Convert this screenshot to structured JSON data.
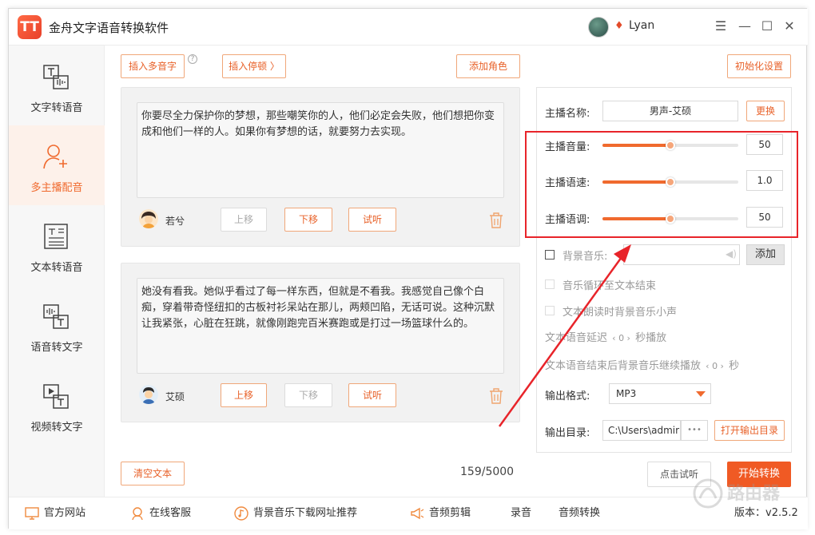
{
  "app": {
    "title": "金舟文字语音转换软件",
    "logo_char": "TT",
    "username": "Lyan",
    "vip_icon": "diamond-icon"
  },
  "window_controls": {
    "menu": "☰",
    "minimize": "—",
    "maximize": "☐",
    "close": "✕"
  },
  "sidebar": {
    "items": [
      {
        "label": "文字转语音",
        "icon": "text-to-speech-icon",
        "active": false
      },
      {
        "label": "多主播配音",
        "icon": "add-user-icon",
        "active": true
      },
      {
        "label": "文本转语音",
        "icon": "document-icon",
        "active": false
      },
      {
        "label": "语音转文字",
        "icon": "speech-to-text-icon",
        "active": false
      },
      {
        "label": "视频转文字",
        "icon": "video-to-text-icon",
        "active": false
      }
    ]
  },
  "toolbar": {
    "insert_polyphone": "插入多音字",
    "help": "?",
    "insert_pause": "插入停顿 〉",
    "add_role": "添加角色",
    "init_settings": "初始化设置"
  },
  "cards": [
    {
      "text": "你要尽全力保护你的梦想，那些嘲笑你的人，他们必定会失败，他们想把你变成和他们一样的人。如果你有梦想的话，就要努力去实现。",
      "speaker": "若兮",
      "move_up": "上移",
      "move_down": "下移",
      "listen": "试听"
    },
    {
      "text": "她没有看我。她似乎看过了每一样东西，但就是不看我。我感觉自己像个白痴，穿着带奇怪纽扣的古板衬衫呆站在那儿，两颊凹陷，无话可说。这种沉默让我紧张，心脏在狂跳，就像刚跑完百米赛跑或是打过一场篮球什么的。",
      "speaker": "艾硕",
      "move_up": "上移",
      "move_down": "下移",
      "listen": "试听"
    }
  ],
  "clear_text": "清空文本",
  "char_count": "159/5000",
  "settings": {
    "anchor_label": "主播名称:",
    "anchor_value": "男声-艾硕",
    "change": "更换",
    "volume_label": "主播音量:",
    "volume_value": "50",
    "volume_level": 0.5,
    "speed_label": "主播语速:",
    "speed_value": "1.0",
    "speed_level": 0.5,
    "pitch_label": "主播语调:",
    "pitch_value": "50",
    "pitch_level": 0.5,
    "bgm_label": "背景音乐:",
    "bgm_add": "添加",
    "loop_label": "音乐循环至文本结束",
    "duck_label": "文本朗读时背景音乐小声",
    "delay_label": "文本语音延迟",
    "delay_value": "0",
    "delay_unit": "秒播放",
    "continue_label": "文本语音结束后背景音乐继续播放",
    "continue_value": "0",
    "continue_unit": "秒",
    "format_label": "输出格式:",
    "format_value": "MP3",
    "dir_label": "输出目录:",
    "dir_value": "C:\\Users\\admir",
    "dir_more": "•••",
    "open_dir": "打开输出目录"
  },
  "actions": {
    "preview": "点击试听",
    "start": "开始转换"
  },
  "bottom": {
    "website": "官方网站",
    "support": "在线客服",
    "bgm_sites": "背景音乐下载网址推荐",
    "audio_cut": "音频剪辑",
    "record": "录音",
    "audio_convert": "音频转换",
    "version": "版本：v2.5.2"
  },
  "colors": {
    "accent": "#f06a2e",
    "annotation": "#e8242a"
  },
  "watermark": "路由器"
}
